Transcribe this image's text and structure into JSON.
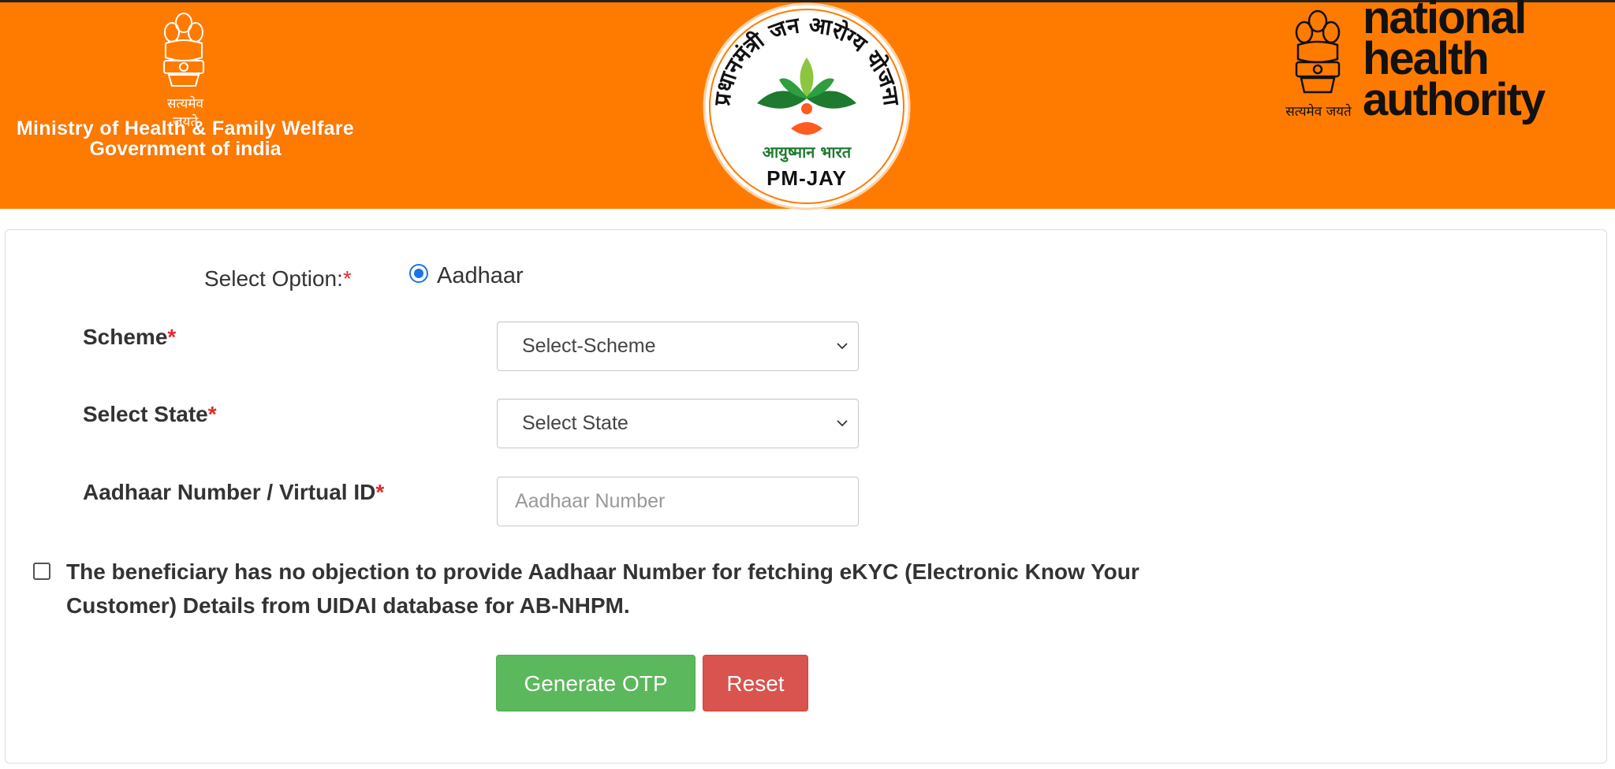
{
  "header": {
    "left_emblem_motto": "सत्यमेव जयते",
    "ministry_line1": "Ministry of Health & Family Welfare",
    "ministry_line2": "Government of india",
    "pmjay_ring_text": "प्रधानमंत्री जन आरोग्य योजना",
    "pmjay_subtext": "आयुष्मान भारत",
    "pmjay_abbr": "PM-JAY",
    "right_emblem_motto": "सत्यमेव जयते",
    "nha_line1": "national",
    "nha_line2": "health",
    "nha_line3": "authority"
  },
  "form": {
    "select_option_label": "Select Option:",
    "required_mark": "*",
    "radio_option_label": "Aadhaar",
    "radio_checked": true,
    "scheme_label": "Scheme",
    "scheme_value": "Select-Scheme",
    "state_label": "Select State",
    "state_value": "Select State",
    "aadhaar_label": "Aadhaar Number / Virtual ID",
    "aadhaar_placeholder": "Aadhaar Number",
    "aadhaar_value": "",
    "consent_checked": false,
    "consent_text": "The beneficiary has no objection to provide Aadhaar Number for fetching eKYC (Electronic Know Your Customer) Details from UIDAI database for AB-NHPM.",
    "generate_otp_label": "Generate OTP",
    "reset_label": "Reset"
  },
  "colors": {
    "header_bg": "#ff7b00",
    "required": "#e02b2b",
    "primary_green": "#5cb85c",
    "danger_red": "#d9534f",
    "radio_blue": "#1a73e8"
  },
  "icons": {
    "scheme_dropdown": "chevron-down-icon",
    "state_dropdown": "chevron-down-icon",
    "left_logo": "national-emblem-icon",
    "center_logo": "pmjay-logo",
    "right_logo": "national-emblem-icon"
  }
}
